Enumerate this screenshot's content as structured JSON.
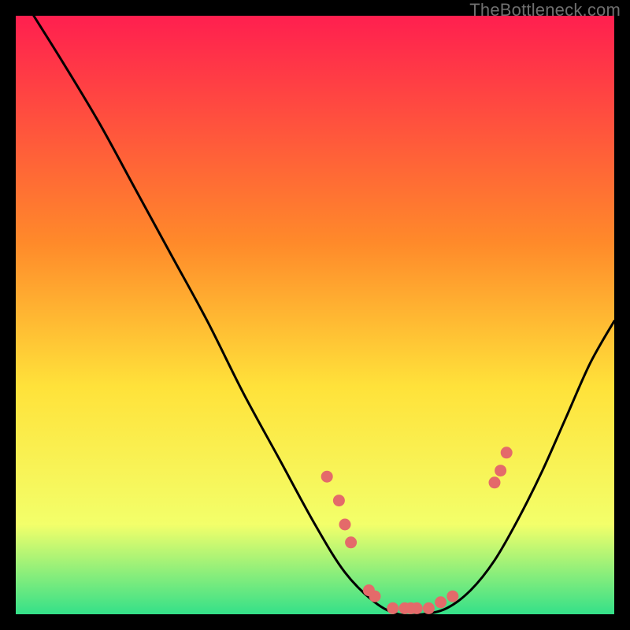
{
  "watermark": "TheBottleneck.com",
  "colors": {
    "gradient_top": "#ff1f4f",
    "gradient_mid1": "#ff8a2a",
    "gradient_mid2": "#ffe23a",
    "gradient_mid3": "#f3ff6a",
    "gradient_bottom": "#34e089",
    "curve": "#000000",
    "marker": "#e46a6a",
    "frame_bg": "#000000"
  },
  "chart_data": {
    "type": "line",
    "title": "",
    "xlabel": "",
    "ylabel": "",
    "xlim": [
      0,
      100
    ],
    "ylim": [
      0,
      100
    ],
    "grid": false,
    "legend": false,
    "curve_percent": [
      {
        "x": 3,
        "y": 100
      },
      {
        "x": 8,
        "y": 92
      },
      {
        "x": 14,
        "y": 82
      },
      {
        "x": 20,
        "y": 71
      },
      {
        "x": 26,
        "y": 60
      },
      {
        "x": 32,
        "y": 49
      },
      {
        "x": 38,
        "y": 37
      },
      {
        "x": 44,
        "y": 26
      },
      {
        "x": 50,
        "y": 15
      },
      {
        "x": 55,
        "y": 7
      },
      {
        "x": 60,
        "y": 2
      },
      {
        "x": 64,
        "y": 0
      },
      {
        "x": 68,
        "y": 0
      },
      {
        "x": 72,
        "y": 1
      },
      {
        "x": 76,
        "y": 4
      },
      {
        "x": 80,
        "y": 9
      },
      {
        "x": 84,
        "y": 16
      },
      {
        "x": 88,
        "y": 24
      },
      {
        "x": 92,
        "y": 33
      },
      {
        "x": 96,
        "y": 42
      },
      {
        "x": 100,
        "y": 49
      }
    ],
    "markers_percent": [
      {
        "x": 52,
        "y": 23
      },
      {
        "x": 54,
        "y": 19
      },
      {
        "x": 55,
        "y": 15
      },
      {
        "x": 56,
        "y": 12
      },
      {
        "x": 59,
        "y": 4
      },
      {
        "x": 60,
        "y": 3
      },
      {
        "x": 63,
        "y": 1
      },
      {
        "x": 65,
        "y": 1
      },
      {
        "x": 66,
        "y": 1
      },
      {
        "x": 67,
        "y": 1
      },
      {
        "x": 69,
        "y": 1
      },
      {
        "x": 71,
        "y": 2
      },
      {
        "x": 73,
        "y": 3
      },
      {
        "x": 80,
        "y": 22
      },
      {
        "x": 81,
        "y": 24
      },
      {
        "x": 82,
        "y": 27
      }
    ]
  }
}
